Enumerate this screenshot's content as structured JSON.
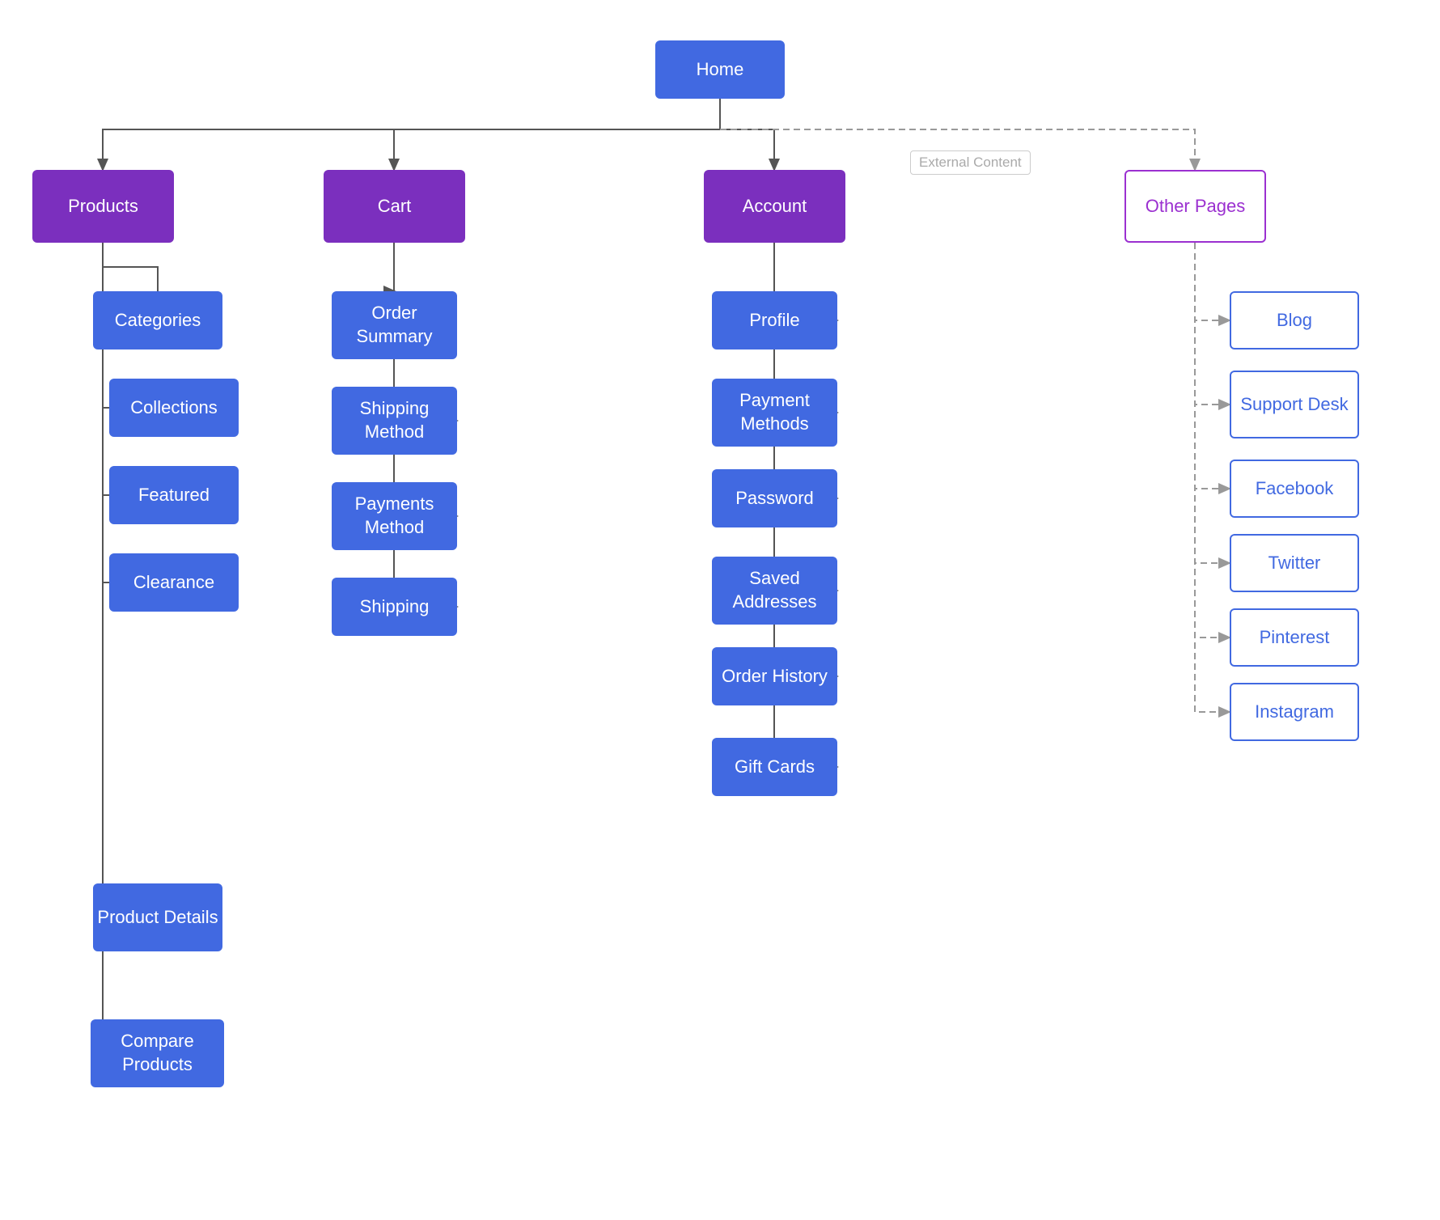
{
  "nodes": {
    "home": "Home",
    "products": "Products",
    "cart": "Cart",
    "account": "Account",
    "other_pages": "Other Pages",
    "categories": "Categories",
    "collections": "Collections",
    "featured": "Featured",
    "clearance": "Clearance",
    "product_details": "Product Details",
    "compare_products": "Compare Products",
    "order_summary": "Order Summary",
    "shipping_method": "Shipping Method",
    "payments_method": "Payments Method",
    "shipping": "Shipping",
    "profile": "Profile",
    "payment_methods": "Payment Methods",
    "password": "Password",
    "saved_addresses": "Saved Addresses",
    "order_history": "Order History",
    "gift_cards": "Gift Cards",
    "blog": "Blog",
    "support_desk": "Support Desk",
    "facebook": "Facebook",
    "twitter": "Twitter",
    "pinterest": "Pinterest",
    "instagram": "Instagram",
    "external_content": "External Content"
  }
}
